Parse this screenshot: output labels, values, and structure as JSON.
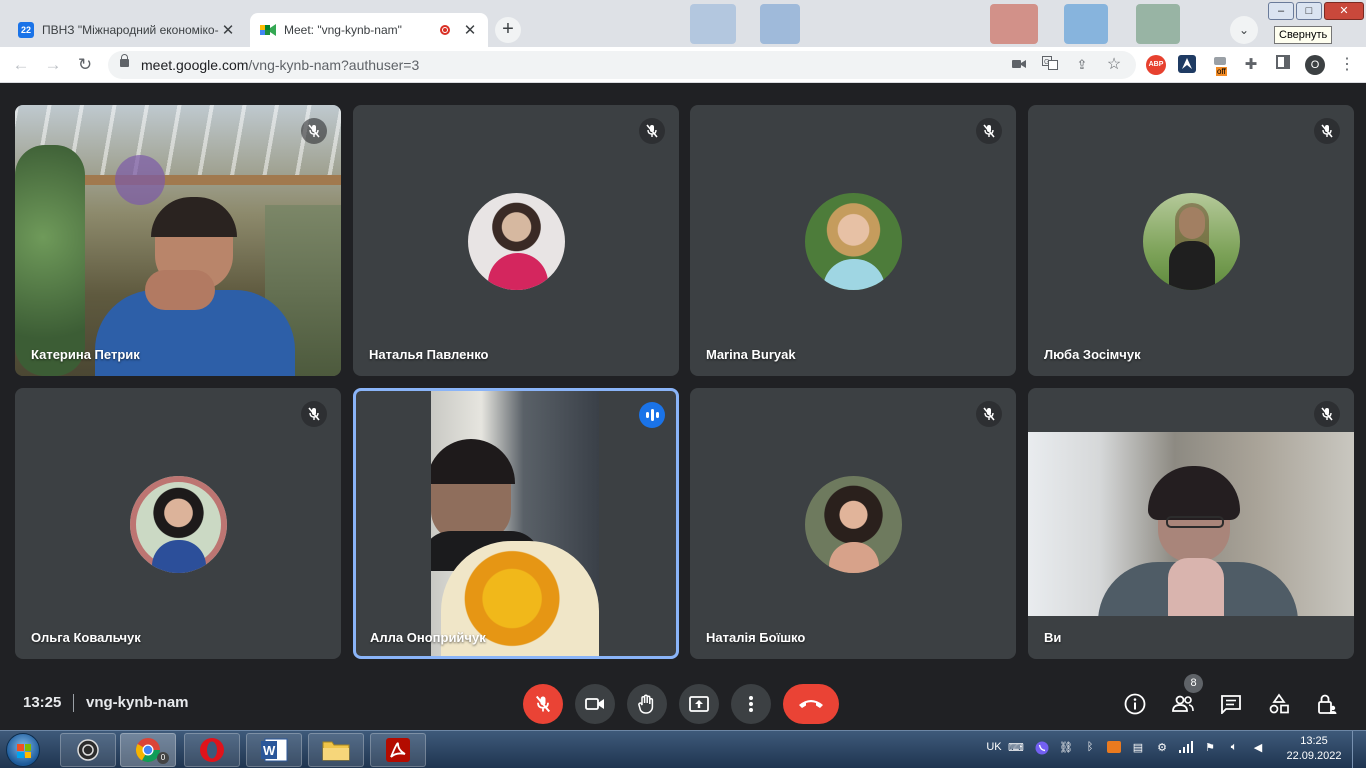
{
  "browser": {
    "tabs": [
      {
        "title": "ПВНЗ \"Міжнародний економіко-",
        "favicon_color": "#1a73e8",
        "favicon_text": "22",
        "active": false
      },
      {
        "title": "Meet: \"vng-kynb-nam\"",
        "favicon_color": "#00832d",
        "favicon_text": "",
        "active": true,
        "recording": true
      }
    ],
    "new_tab_label": "+",
    "window_tooltip": "Свернуть",
    "url_host": "meet.google.com",
    "url_path": "/vng-kynb-nam?authuser=3",
    "extensions": {
      "abp_label": "ABP",
      "off_badge": "off",
      "profile_initial": "O"
    }
  },
  "participants": [
    {
      "name": "Катерина Петрик",
      "muted": true,
      "video": true
    },
    {
      "name": "Наталья Павленко",
      "muted": true,
      "video": false
    },
    {
      "name": "Marina Buryak",
      "muted": true,
      "video": false
    },
    {
      "name": "Люба Зосімчук",
      "muted": true,
      "video": false
    },
    {
      "name": "Ольга Ковальчук",
      "muted": true,
      "video": false
    },
    {
      "name": "Алла Оноприйчук",
      "muted": false,
      "video": true,
      "speaking": true
    },
    {
      "name": "Наталія Боїшко",
      "muted": true,
      "video": false
    },
    {
      "name": "Ви",
      "muted": true,
      "video": true
    }
  ],
  "meeting": {
    "time": "13:25",
    "code": "vng-kynb-nam",
    "people_count": "8",
    "controls": [
      "mic-off",
      "camera",
      "raise-hand",
      "present",
      "more",
      "leave"
    ],
    "right_controls": [
      "info",
      "people",
      "chat",
      "activities",
      "host-controls"
    ]
  },
  "taskbar": {
    "apps": [
      "hotkeys",
      "chrome",
      "opera",
      "word",
      "explorer",
      "acrobat"
    ],
    "chrome_badge": "0",
    "language": "UK",
    "clock_time": "13:25",
    "clock_date": "22.09.2022"
  },
  "colors": {
    "meet_bg": "#202124",
    "tile_bg": "#3c4043",
    "danger": "#ea4335",
    "speaking_border": "#8ab4f8",
    "speaking_badge": "#1a73e8"
  }
}
